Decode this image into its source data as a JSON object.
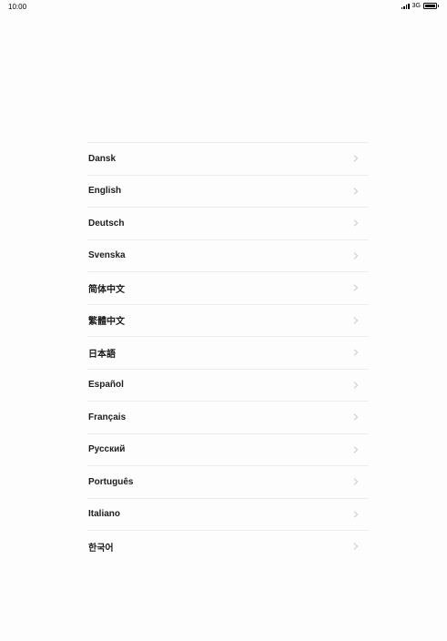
{
  "status_bar": {
    "time": "10:00",
    "network": "3G",
    "icons": [
      "signal-bars-icon",
      "battery-icon"
    ]
  },
  "languages": [
    {
      "label": "Dansk"
    },
    {
      "label": "English"
    },
    {
      "label": "Deutsch"
    },
    {
      "label": "Svenska"
    },
    {
      "label": "简体中文"
    },
    {
      "label": "繁體中文"
    },
    {
      "label": "日本語"
    },
    {
      "label": "Español"
    },
    {
      "label": "Français"
    },
    {
      "label": "Русский"
    },
    {
      "label": "Português"
    },
    {
      "label": "Italiano"
    },
    {
      "label": "한국어"
    }
  ],
  "colors": {
    "background": "#fdfdfd",
    "text": "#1c1c1e",
    "separator": "#ececec",
    "chevron": "#c7c7cc"
  }
}
